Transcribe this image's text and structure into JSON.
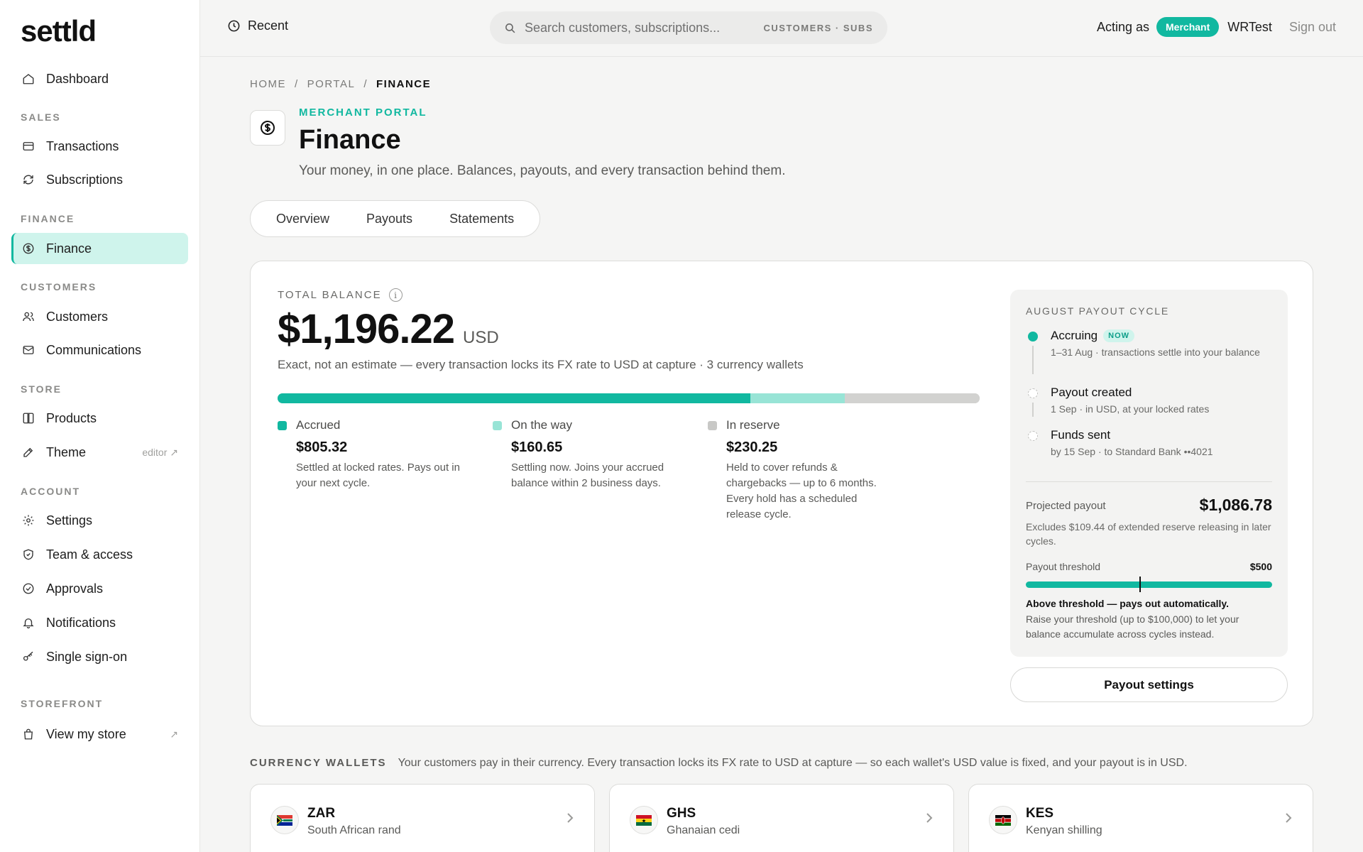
{
  "app": {
    "logo": "settld"
  },
  "sidebar": {
    "dashboard": "Dashboard",
    "sections": {
      "sales": "SALES",
      "finance": "FINANCE",
      "customers": "CUSTOMERS",
      "store": "STORE",
      "account": "ACCOUNT",
      "storefront": "STOREFRONT"
    },
    "items": {
      "transactions": "Transactions",
      "subscriptions": "Subscriptions",
      "finance": "Finance",
      "customers": "Customers",
      "communications": "Communications",
      "products": "Products",
      "theme": "Theme",
      "theme_aside": "editor ↗",
      "settings": "Settings",
      "team": "Team & access",
      "approvals": "Approvals",
      "notifications": "Notifications",
      "sso": "Single sign-on",
      "view_store": "View my store",
      "view_store_aside": "↗"
    }
  },
  "topbar": {
    "recent": "Recent",
    "search_placeholder": "Search customers, subscriptions...",
    "search_scope": "CUSTOMERS · SUBS",
    "acting_as": "Acting as",
    "role_badge": "Merchant",
    "account": "WRTest",
    "sign_out": "Sign out"
  },
  "header": {
    "breadcrumb": [
      "HOME",
      "/",
      "PORTAL",
      "/",
      "FINANCE"
    ],
    "eyebrow": "MERCHANT PORTAL",
    "title": "Finance",
    "subtitle": "Your money, in one place. Balances, payouts, and every transaction behind them.",
    "tabs": [
      "Overview",
      "Payouts",
      "Statements"
    ]
  },
  "balance": {
    "label": "TOTAL BALANCE",
    "amount": "$1,196.22",
    "currency": "USD",
    "note": "Exact, not an estimate — every transaction locks its FX rate to USD at capture · 3 currency wallets",
    "breakdown": [
      {
        "name": "Accrued",
        "value": "$805.32",
        "amount": 805.32,
        "color": "#11b8a0",
        "desc": "Settled at locked rates. Pays out in your next cycle."
      },
      {
        "name": "On the way",
        "value": "$160.65",
        "amount": 160.65,
        "color": "#98e4d6",
        "desc": "Settling now. Joins your accrued balance within 2 business days."
      },
      {
        "name": "In reserve",
        "value": "$230.25",
        "amount": 230.25,
        "color": "#d2d2d0",
        "desc": "Held to cover refunds & chargebacks — up to 6 months. Every hold has a scheduled release cycle."
      }
    ]
  },
  "cycle": {
    "title": "AUGUST PAYOUT CYCLE",
    "steps": [
      {
        "name": "Accruing",
        "badge": "NOW",
        "detail": "1–31 Aug · transactions settle into your balance"
      },
      {
        "name": "Payout created",
        "detail": "1 Sep · in USD, at your locked rates"
      },
      {
        "name": "Funds sent",
        "detail": "by 15 Sep · to Standard Bank ••4021"
      }
    ],
    "projected_label": "Projected payout",
    "projected_value": "$1,086.78",
    "projected_note": "Excludes $109.44 of extended reserve releasing in later cycles.",
    "threshold_label": "Payout threshold",
    "threshold_value": "$500",
    "threshold_level": 0.46,
    "threshold_head": "Above threshold — pays out automatically.",
    "threshold_note": "Raise your threshold (up to $100,000) to let your balance accumulate across cycles instead.",
    "button": "Payout settings"
  },
  "wallets": {
    "label": "CURRENCY WALLETS",
    "description": "Your customers pay in their currency. Every transaction locks its FX rate to USD at capture — so each wallet's USD value is fixed, and your payout is in USD.",
    "items": [
      {
        "code": "ZAR",
        "name": "South African rand",
        "flag": "za-flag-icon"
      },
      {
        "code": "GHS",
        "name": "Ghanaian cedi",
        "flag": "gh-flag-icon"
      },
      {
        "code": "KES",
        "name": "Kenyan shilling",
        "flag": "ke-flag-icon"
      }
    ]
  },
  "colors": {
    "accent": "#11b8a0",
    "accent_light": "#cff4ec",
    "reserve": "#d2d2d0"
  }
}
